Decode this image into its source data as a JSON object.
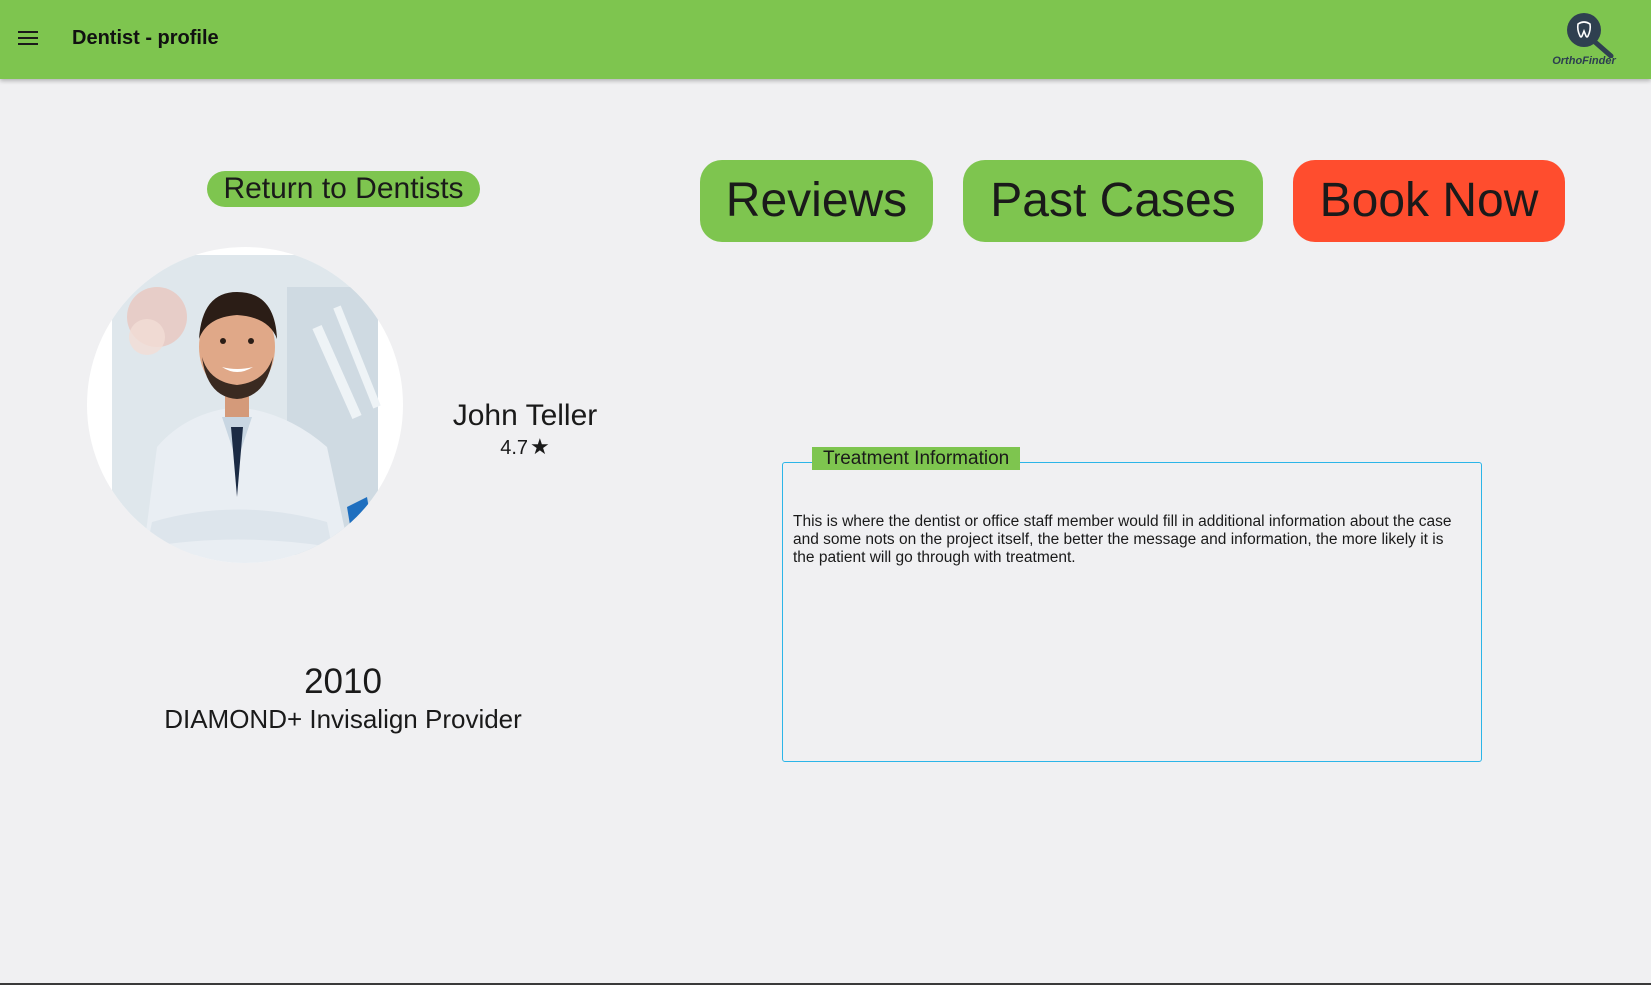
{
  "header": {
    "title": "Dentist - profile",
    "menu_icon": "menu-icon",
    "logo_text": "OrthoFinder",
    "background_color": "#7ec54f"
  },
  "navigation": {
    "return_label": "Return to Dentists"
  },
  "actions": {
    "reviews_label": "Reviews",
    "past_cases_label": "Past Cases",
    "book_now_label": "Book Now",
    "primary_color": "#7ec54f",
    "book_color": "#ff4d2e"
  },
  "dentist": {
    "name": "John Teller",
    "rating": "4.7",
    "rating_icon": "star-icon",
    "year": "2010",
    "provider_level": "DIAMOND+ Invisalign Provider"
  },
  "treatment": {
    "legend": "Treatment Information",
    "text": "This is where the dentist or office staff member would fill in additional information about the case and some nots on the project itself, the better the message and information, the more likely it is the patient will go through with treatment.",
    "border_color": "#2bb5e8"
  }
}
